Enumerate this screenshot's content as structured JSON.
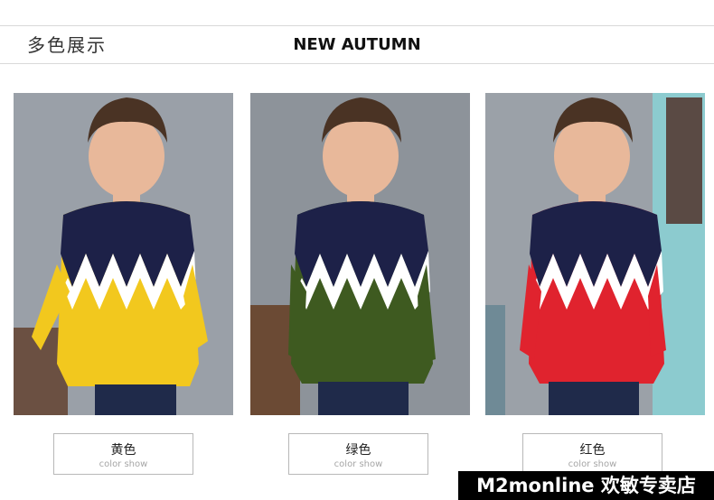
{
  "header": {
    "section_title": "多色展示",
    "main_title": "NEW AUTUMN"
  },
  "products": [
    {
      "color_name": "黄色",
      "color_caption": "color show",
      "sweater_color": "#f2c81e",
      "background": "#9aa0a8"
    },
    {
      "color_name": "绿色",
      "color_caption": "color show",
      "sweater_color": "#3e5a20",
      "background": "#8d939a"
    },
    {
      "color_name": "红色",
      "color_caption": "color show",
      "sweater_color": "#e0232e",
      "background": "#9ba1a8"
    }
  ],
  "colors": {
    "navy": "#1d2148",
    "skin": "#e8b89a",
    "hair": "#4a3324",
    "jeans": "#1f2a4a"
  },
  "watermark": {
    "text": "M2monline 欢敏专卖店"
  }
}
